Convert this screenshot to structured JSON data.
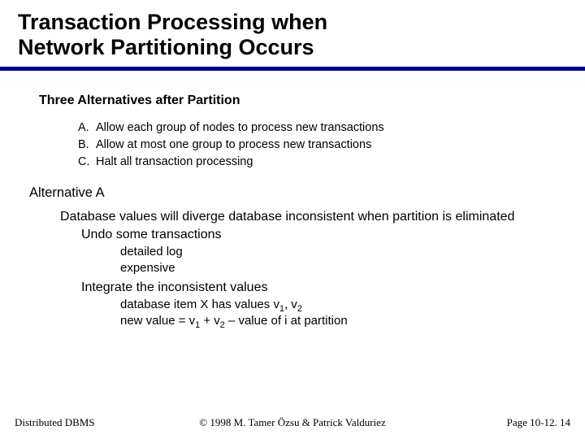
{
  "title_line1": "Transaction Processing when",
  "title_line2": "Network Partitioning Occurs",
  "section1_heading": "Three Alternatives after Partition",
  "alts": {
    "a_label": "A.",
    "a_text": "Allow each group of nodes to process new transactions",
    "b_label": "B.",
    "b_text": "Allow at most one group to process new transactions",
    "c_label": "C.",
    "c_text": "Halt all transaction processing"
  },
  "altA_heading": "Alternative A",
  "altA_line1": "Database values will diverge database inconsistent when partition is eliminated",
  "altA_undo": "Undo some transactions",
  "altA_undo_d1": "detailed log",
  "altA_undo_d2": "expensive",
  "altA_integrate": "Integrate the inconsistent values",
  "altA_int_d1_pre": "database item X has values v",
  "altA_int_d1_mid": ", v",
  "altA_int_d2_pre": "new value = v",
  "altA_int_d2_mid": " + v",
  "altA_int_d2_post": " – value of i at partition",
  "sub1": "1",
  "sub2": "2",
  "footer_left": "Distributed DBMS",
  "footer_center": "© 1998 M. Tamer Özsu & Patrick Valduriez",
  "footer_right": "Page 10-12. 14"
}
